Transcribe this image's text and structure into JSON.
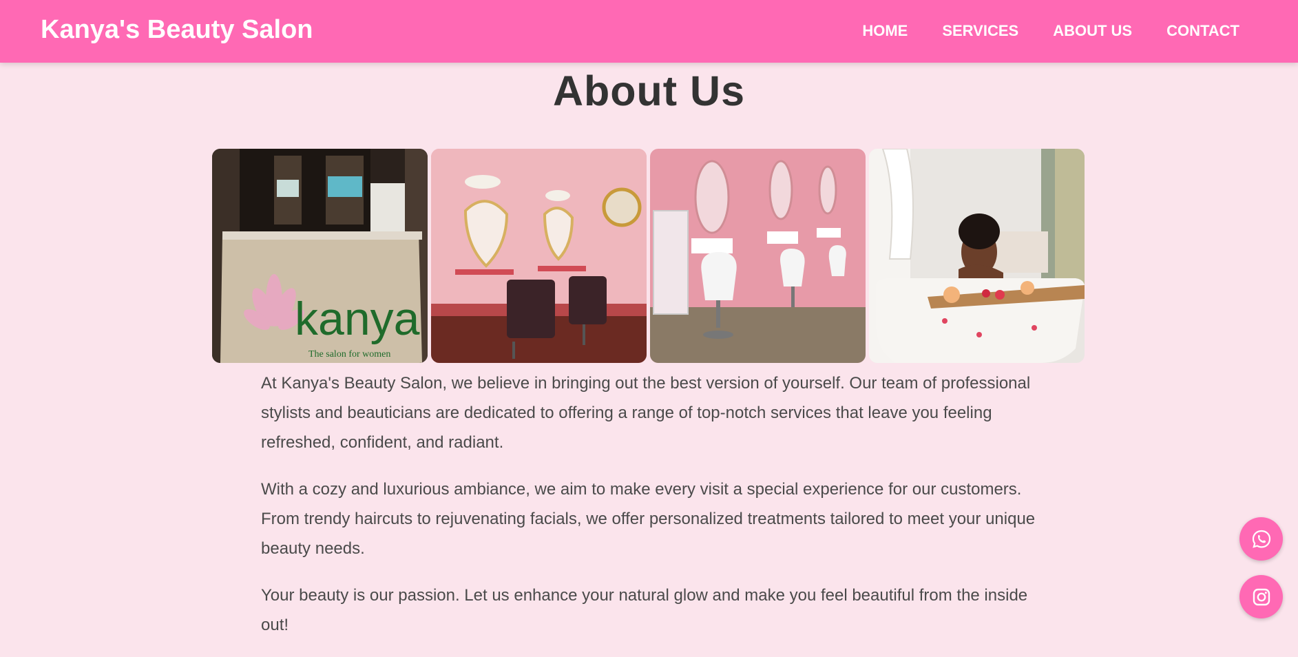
{
  "header": {
    "brand": "Kanya's Beauty Salon",
    "nav": [
      {
        "label": "HOME"
      },
      {
        "label": "SERVICES"
      },
      {
        "label": "ABOUT US"
      },
      {
        "label": "CONTACT"
      }
    ]
  },
  "about": {
    "title": "About Us",
    "gallery": [
      {
        "icon": "reception-desk-photo",
        "sign_text": "kanya",
        "sign_subtext": "The salon for women"
      },
      {
        "icon": "salon-chairs-heart-mirrors-photo"
      },
      {
        "icon": "salon-pink-stations-photo"
      },
      {
        "icon": "woman-bathtub-spa-photo"
      }
    ],
    "paragraphs": [
      "At Kanya's Beauty Salon, we believe in bringing out the best version of yourself. Our team of professional stylists and beauticians are dedicated to offering a range of top-notch services that leave you feeling refreshed, confident, and radiant.",
      "With a cozy and luxurious ambiance, we aim to make every visit a special experience for our customers. From trendy haircuts to rejuvenating facials, we offer personalized treatments tailored to meet your unique beauty needs.",
      "Your beauty is our passion. Let us enhance your natural glow and make you feel beautiful from the inside out!"
    ]
  },
  "floating_buttons": [
    {
      "icon": "whatsapp-icon"
    },
    {
      "icon": "instagram-icon"
    }
  ],
  "colors": {
    "primary": "#ff69b4",
    "background": "#fbe4ec",
    "heading": "#333333",
    "body_text": "#4a4a4a"
  }
}
